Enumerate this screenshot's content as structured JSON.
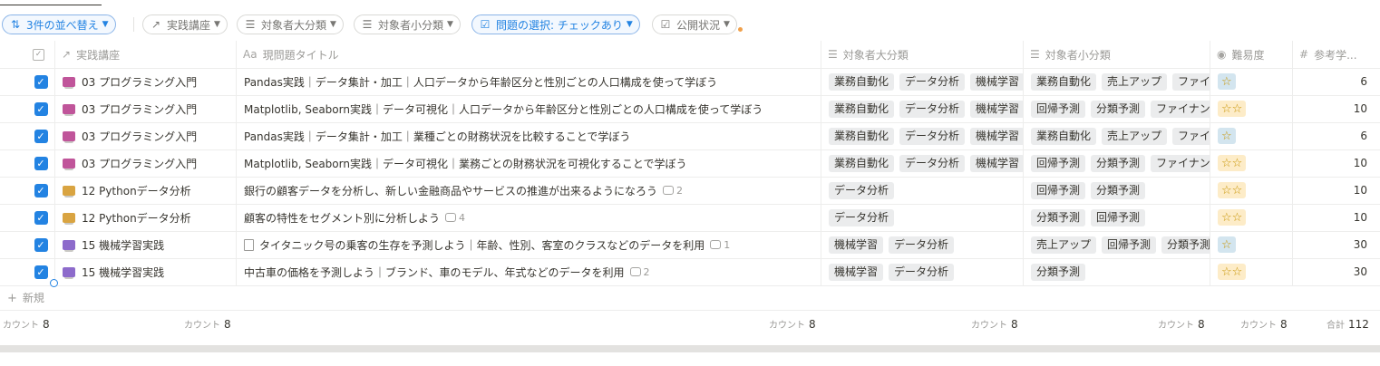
{
  "toolbar": {
    "sort_label": "3件の並べ替え",
    "filters": [
      {
        "label": "実践講座",
        "icon": "arrow-up-right-icon"
      },
      {
        "label": "対象者大分類",
        "icon": "list-icon"
      },
      {
        "label": "対象者小分類",
        "icon": "list-icon"
      },
      {
        "label": "問題の選択: チェックあり",
        "icon": "checkbox-icon",
        "active": true
      },
      {
        "label": "公開状況",
        "icon": "checkbox-icon"
      }
    ]
  },
  "columns": {
    "course": "実践講座",
    "title": "現問題タイトル",
    "major": "対象者大分類",
    "minor": "対象者小分類",
    "difficulty": "難易度",
    "ref": "参考学..."
  },
  "column_icons": {
    "title": "Aa"
  },
  "rows": [
    {
      "course": "03 プログラミング入門",
      "course_color": "pink",
      "title": "Pandas実践｜データ集計・加工｜人口データから年齢区分と性別ごとの人口構成を使って学ぼう",
      "major": [
        "業務自動化",
        "データ分析",
        "機械学習"
      ],
      "minor": [
        "業務自動化",
        "売上アップ",
        "ファイ"
      ],
      "difficulty": "one",
      "ref": "6"
    },
    {
      "course": "03 プログラミング入門",
      "course_color": "pink",
      "title": "Matplotlib, Seaborn実践｜データ可視化｜人口データから年齢区分と性別ごとの人口構成を使って学ぼう",
      "major": [
        "業務自動化",
        "データ分析",
        "機械学習"
      ],
      "minor": [
        "回帰予測",
        "分類予測",
        "ファイナン"
      ],
      "difficulty": "two",
      "ref": "10"
    },
    {
      "course": "03 プログラミング入門",
      "course_color": "pink",
      "title": "Pandas実践｜データ集計・加工｜業種ごとの財務状況を比較することで学ぼう",
      "major": [
        "業務自動化",
        "データ分析",
        "機械学習"
      ],
      "minor": [
        "業務自動化",
        "売上アップ",
        "ファイ"
      ],
      "difficulty": "one",
      "ref": "6"
    },
    {
      "course": "03 プログラミング入門",
      "course_color": "pink",
      "title": "Matplotlib, Seaborn実践｜データ可視化｜業務ごとの財務状況を可視化することで学ぼう",
      "major": [
        "業務自動化",
        "データ分析",
        "機械学習"
      ],
      "minor": [
        "回帰予測",
        "分類予測",
        "ファイナン"
      ],
      "difficulty": "two",
      "ref": "10"
    },
    {
      "course": "12 Pythonデータ分析",
      "course_color": "orange",
      "title": "銀行の顧客データを分析し、新しい金融商品やサービスの推進が出来るようになろう",
      "comments": "2",
      "major": [
        "データ分析"
      ],
      "minor": [
        "回帰予測",
        "分類予測"
      ],
      "difficulty": "two",
      "ref": "10"
    },
    {
      "course": "12 Pythonデータ分析",
      "course_color": "orange",
      "title": "顧客の特性をセグメント別に分析しよう",
      "comments": "4",
      "major": [
        "データ分析"
      ],
      "minor": [
        "分類予測",
        "回帰予測"
      ],
      "difficulty": "two",
      "ref": "10"
    },
    {
      "course": "15 機械学習実践",
      "course_color": "purple",
      "doc": true,
      "title": "タイタニック号の乗客の生存を予測しよう｜年齢、性別、客室のクラスなどのデータを利用",
      "comments": "1",
      "major": [
        "機械学習",
        "データ分析"
      ],
      "minor": [
        "売上アップ",
        "回帰予測",
        "分類予測"
      ],
      "difficulty": "one",
      "ref": "30"
    },
    {
      "course": "15 機械学習実践",
      "course_color": "purple",
      "title": "中古車の価格を予測しよう｜ブランド、車のモデル、年式などのデータを利用",
      "comments": "2",
      "major": [
        "機械学習",
        "データ分析"
      ],
      "minor": [
        "分類予測"
      ],
      "difficulty": "two",
      "ref": "30"
    }
  ],
  "new_row_label": "新規",
  "footer": [
    {
      "label": "カウント",
      "value": "8"
    },
    {
      "label": "カウント",
      "value": "8"
    },
    {
      "label": "カウント",
      "value": "8"
    },
    {
      "label": "カウント",
      "value": "8"
    },
    {
      "label": "カウント",
      "value": "8"
    },
    {
      "label": "カウント",
      "value": "8"
    },
    {
      "label": "合計",
      "value": "112"
    }
  ]
}
